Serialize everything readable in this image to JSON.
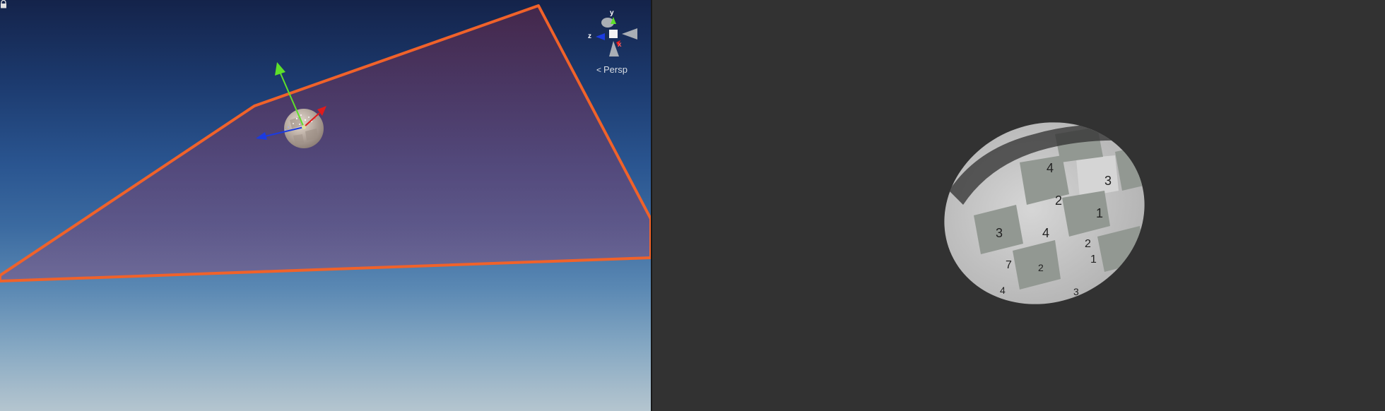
{
  "scene_view": {
    "camera_mode_label": "Persp",
    "orientation_gizmo": {
      "axis_y": "y",
      "axis_z": "z",
      "axis_x": "x"
    },
    "colors": {
      "frustum_outline": "#f0622a",
      "axis_x": "#e01b1b",
      "axis_y": "#5ee02a",
      "axis_z": "#1b3be0"
    }
  },
  "preview_view": {
    "sphere_labels": [
      "4",
      "3",
      "2",
      "1",
      "3",
      "4",
      "2",
      "1",
      "7",
      "2",
      "4",
      "3"
    ]
  }
}
